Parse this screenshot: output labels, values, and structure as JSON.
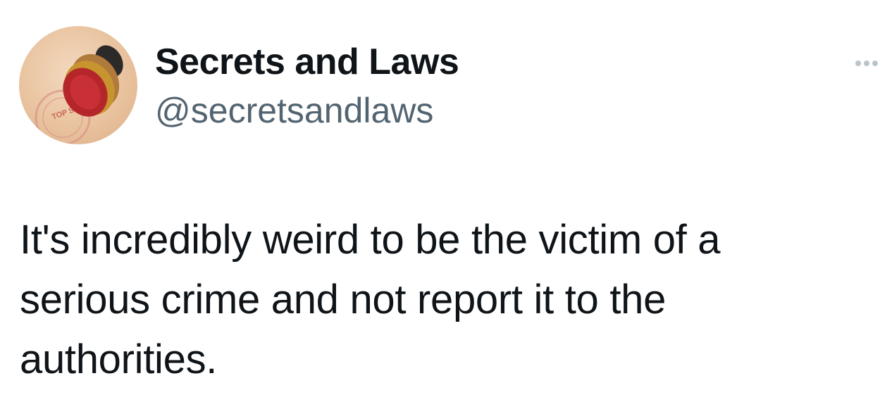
{
  "author": {
    "display_name": "Secrets and Laws",
    "handle": "@secretsandlaws",
    "avatar_icon": "top-secret-stamp-icon",
    "avatar_stamp_text": "TOP SECRET"
  },
  "more_icon": "more-horizontal-icon",
  "tweet": {
    "text": "It's incredibly weird to be the victim of a serious crime and not report it to the authorities."
  },
  "colors": {
    "text_primary": "#0f1419",
    "text_secondary": "#536471",
    "stamp_red": "#c0242b",
    "avatar_bg": "#e9c39f"
  }
}
